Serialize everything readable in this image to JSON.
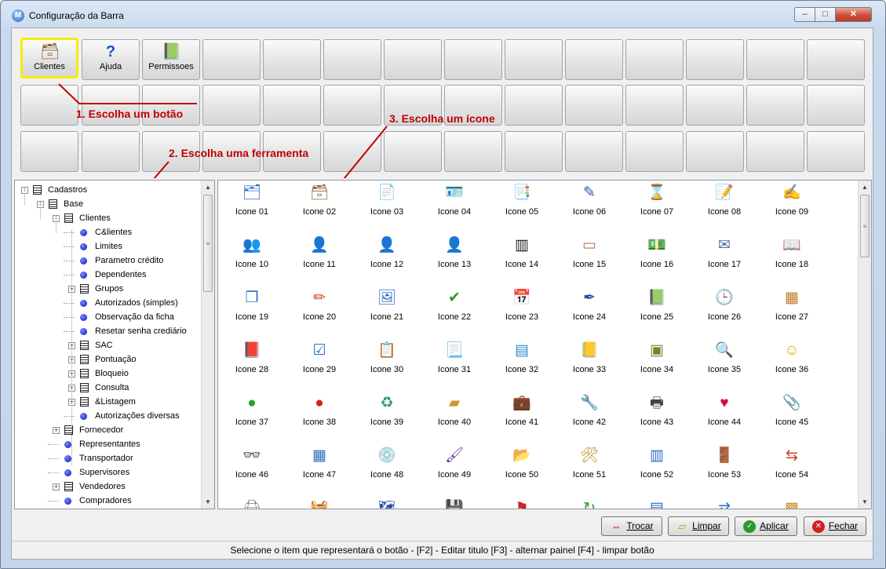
{
  "window": {
    "title": "Configuração da Barra",
    "app_icon": "app-logo-icon",
    "controls": {
      "minimize": "–",
      "maximize": "□",
      "close": "✕"
    }
  },
  "toolbar_buttons": [
    {
      "label": "Clientes",
      "icon": "card-file-icon",
      "selected": true
    },
    {
      "label": "Ajuda",
      "icon": "question-mark-icon"
    },
    {
      "label": "Permissoes",
      "icon": "green-book-icon"
    }
  ],
  "annotations": {
    "step1": "1. Escolha um botão",
    "step2": "2. Escolha uma ferramenta",
    "step3": "3. Escolha um ícone"
  },
  "tree": {
    "items": [
      {
        "label": "Cadastros",
        "type": "doc",
        "level": 0,
        "expander": "-"
      },
      {
        "label": "Base",
        "type": "doc",
        "level": 1,
        "expander": "-"
      },
      {
        "label": "Clientes",
        "type": "doc",
        "level": 2,
        "expander": "-"
      },
      {
        "label": "C&lientes",
        "type": "dot",
        "level": 3
      },
      {
        "label": "Limites",
        "type": "dot",
        "level": 3
      },
      {
        "label": "Parametro crédito",
        "type": "dot",
        "level": 3
      },
      {
        "label": "Dependentes",
        "type": "dot",
        "level": 3
      },
      {
        "label": "Grupos",
        "type": "doc",
        "level": 3,
        "expander": "+"
      },
      {
        "label": "Autorizados (simples)",
        "type": "dot",
        "level": 3
      },
      {
        "label": "Observação da ficha",
        "type": "dot",
        "level": 3
      },
      {
        "label": "Resetar senha crediário",
        "type": "dot",
        "level": 3
      },
      {
        "label": "SAC",
        "type": "doc",
        "level": 3,
        "expander": "+"
      },
      {
        "label": "Pontuação",
        "type": "doc",
        "level": 3,
        "expander": "+"
      },
      {
        "label": "Bloqueio",
        "type": "doc",
        "level": 3,
        "expander": "+"
      },
      {
        "label": "Consulta",
        "type": "doc",
        "level": 3,
        "expander": "+"
      },
      {
        "label": "&Listagem",
        "type": "doc",
        "level": 3,
        "expander": "+"
      },
      {
        "label": "Autorizações diversas",
        "type": "dot",
        "level": 3
      },
      {
        "label": "Fornecedor",
        "type": "doc",
        "level": 2,
        "expander": "+"
      },
      {
        "label": "Representantes",
        "type": "dot",
        "level": 2
      },
      {
        "label": "Transportador",
        "type": "dot",
        "level": 2
      },
      {
        "label": "Supervisores",
        "type": "dot",
        "level": 2
      },
      {
        "label": "Vendedores",
        "type": "doc",
        "level": 2,
        "expander": "+"
      },
      {
        "label": "Compradores",
        "type": "dot",
        "level": 2
      }
    ]
  },
  "icons": [
    {
      "label": "Icone 01",
      "glyph": "🗂",
      "color": "#2b6cc4"
    },
    {
      "label": "Icone 02",
      "glyph": "🗃",
      "color": "#8a6a3a"
    },
    {
      "label": "Icone 03",
      "glyph": "📄",
      "color": "#d9b800"
    },
    {
      "label": "Icone 04",
      "glyph": "🪪",
      "color": "#666"
    },
    {
      "label": "Icone 05",
      "glyph": "📑",
      "color": "#3a6fc0"
    },
    {
      "label": "Icone 06",
      "glyph": "✎",
      "color": "#2a5ab0"
    },
    {
      "label": "Icone 07",
      "glyph": "⌛",
      "color": "#2a5ab0"
    },
    {
      "label": "Icone 08",
      "glyph": "📝",
      "color": "#3a6fc0"
    },
    {
      "label": "Icone 09",
      "glyph": "✍",
      "color": "#c08a00"
    },
    {
      "label": "Icone 10",
      "glyph": "👥",
      "color": "#2a8a2a"
    },
    {
      "label": "Icone 11",
      "glyph": "👤",
      "color": "#2a4ab0"
    },
    {
      "label": "Icone 12",
      "glyph": "👤",
      "color": "#6a3a1a"
    },
    {
      "label": "Icone 13",
      "glyph": "👤",
      "color": "#2a4ab0"
    },
    {
      "label": "Icone 14",
      "glyph": "▥",
      "color": "#222"
    },
    {
      "label": "Icone 15",
      "glyph": "▭",
      "color": "#b07a5a"
    },
    {
      "label": "Icone 16",
      "glyph": "💵",
      "color": "#2a9a2a"
    },
    {
      "label": "Icone 17",
      "glyph": "✉",
      "color": "#4a6aa0"
    },
    {
      "label": "Icone 18",
      "glyph": "📖",
      "color": "#c0762a"
    },
    {
      "label": "Icone 19",
      "glyph": "❐",
      "color": "#2a6cc4"
    },
    {
      "label": "Icone 20",
      "glyph": "✏",
      "color": "#d04020"
    },
    {
      "label": "Icone 21",
      "glyph": "🖼",
      "color": "#2a6cc4"
    },
    {
      "label": "Icone 22",
      "glyph": "✔",
      "color": "#2a9a2a"
    },
    {
      "label": "Icone 23",
      "glyph": "📅",
      "color": "#555"
    },
    {
      "label": "Icone 24",
      "glyph": "✒",
      "color": "#2a4ab0"
    },
    {
      "label": "Icone 25",
      "glyph": "📗",
      "color": "#2a8a2a"
    },
    {
      "label": "Icone 26",
      "glyph": "🕒",
      "color": "#d04020"
    },
    {
      "label": "Icone 27",
      "glyph": "▦",
      "color": "#c07a2a"
    },
    {
      "label": "Icone 28",
      "glyph": "📕",
      "color": "#1a7a2a"
    },
    {
      "label": "Icone 29",
      "glyph": "☑",
      "color": "#2a6cc4"
    },
    {
      "label": "Icone 30",
      "glyph": "📋",
      "color": "#c0a060"
    },
    {
      "label": "Icone 31",
      "glyph": "📃",
      "color": "#3a6fc0"
    },
    {
      "label": "Icone 32",
      "glyph": "▤",
      "color": "#2a8ad0"
    },
    {
      "label": "Icone 33",
      "glyph": "📒",
      "color": "#c09a2a"
    },
    {
      "label": "Icone 34",
      "glyph": "▣",
      "color": "#6a8a2a"
    },
    {
      "label": "Icone 35",
      "glyph": "🔍",
      "color": "#555"
    },
    {
      "label": "Icone 36",
      "glyph": "☺",
      "color": "#d8b800"
    },
    {
      "label": "Icone 37",
      "glyph": "●",
      "color": "#2aa02a"
    },
    {
      "label": "Icone 38",
      "glyph": "●",
      "color": "#d02020"
    },
    {
      "label": "Icone 39",
      "glyph": "♻",
      "color": "#2a9a6a"
    },
    {
      "label": "Icone 40",
      "glyph": "▰",
      "color": "#d09a2a"
    },
    {
      "label": "Icone 41",
      "glyph": "💼",
      "color": "#b0602a"
    },
    {
      "label": "Icone 42",
      "glyph": "🔧",
      "color": "#3a6fc0"
    },
    {
      "label": "Icone 43",
      "glyph": "🖶",
      "color": "#444"
    },
    {
      "label": "Icone 44",
      "glyph": "♥",
      "color": "#d01040"
    },
    {
      "label": "Icone 45",
      "glyph": "📎",
      "color": "#2a4ab0"
    },
    {
      "label": "Icone 46",
      "glyph": "👓",
      "color": "#c08a2a"
    },
    {
      "label": "Icone 47",
      "glyph": "▦",
      "color": "#2a6cc4"
    },
    {
      "label": "Icone 48",
      "glyph": "💿",
      "color": "#8a6ad0"
    },
    {
      "label": "Icone 49",
      "glyph": "🖌",
      "color": "#6a3a9a"
    },
    {
      "label": "Icone 50",
      "glyph": "📂",
      "color": "#2a9a2a"
    },
    {
      "label": "Icone 51",
      "glyph": "🛠",
      "color": "#c08a2a"
    },
    {
      "label": "Icone 52",
      "glyph": "▥",
      "color": "#2a6cc4"
    },
    {
      "label": "Icone 53",
      "glyph": "🚪",
      "color": "#2a6cc4"
    },
    {
      "label": "Icone 54",
      "glyph": "⇆",
      "color": "#d04020"
    },
    {
      "label": "",
      "glyph": "🖨",
      "color": "#888"
    },
    {
      "label": "",
      "glyph": "🧺",
      "color": "#2a9a2a"
    },
    {
      "label": "",
      "glyph": "🗺",
      "color": "#2a4ab0"
    },
    {
      "label": "",
      "glyph": "💾",
      "color": "#2a4ab0"
    },
    {
      "label": "",
      "glyph": "⚑",
      "color": "#d02020"
    },
    {
      "label": "",
      "glyph": "↻",
      "color": "#2a9a2a"
    },
    {
      "label": "",
      "glyph": "▤",
      "color": "#2a6cc4"
    },
    {
      "label": "",
      "glyph": "⇄",
      "color": "#2a6cc4"
    },
    {
      "label": "",
      "glyph": "▩",
      "color": "#d08a2a"
    }
  ],
  "actions": {
    "trocar": {
      "label": "Trocar",
      "icon": "swap-arrows-icon"
    },
    "limpar": {
      "label": "Limpar",
      "icon": "eraser-icon"
    },
    "aplicar": {
      "label": "Aplicar",
      "icon": "check-circle-icon"
    },
    "fechar": {
      "label": "Fechar",
      "icon": "close-circle-icon"
    }
  },
  "status": {
    "text": "Selecione o item que representará o botão - [F2] - Editar titulo     [F3] - alternar painel     [F4] - limpar botão"
  }
}
